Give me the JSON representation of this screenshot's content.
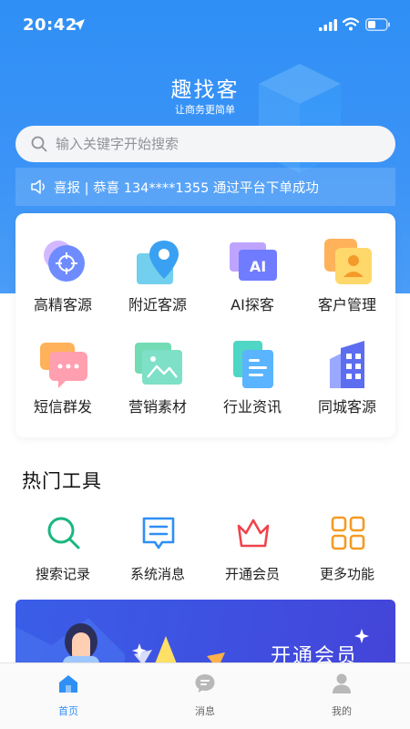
{
  "status_bar": {
    "time": "20:42"
  },
  "header": {
    "title": "趣找客",
    "subtitle": "让商务更简单"
  },
  "search": {
    "placeholder": "输入关键字开始搜索"
  },
  "notice": {
    "text": "喜报 | 恭喜 134****1355 通过平台下单成功"
  },
  "grid": {
    "items": [
      {
        "label": "高精客源",
        "icon": "target-icon"
      },
      {
        "label": "附近客源",
        "icon": "map-pin-icon"
      },
      {
        "label": "AI探客",
        "icon": "ai-icon"
      },
      {
        "label": "客户管理",
        "icon": "user-card-icon"
      },
      {
        "label": "短信群发",
        "icon": "chat-bubble-icon"
      },
      {
        "label": "营销素材",
        "icon": "image-icon"
      },
      {
        "label": "行业资讯",
        "icon": "document-icon"
      },
      {
        "label": "同城客源",
        "icon": "building-icon"
      }
    ]
  },
  "hot_tools": {
    "title": "热门工具",
    "items": [
      {
        "label": "搜索记录",
        "icon": "search-icon",
        "color": "#19b77e"
      },
      {
        "label": "系统消息",
        "icon": "message-icon",
        "color": "#2f8ff5"
      },
      {
        "label": "开通会员",
        "icon": "crown-icon",
        "color": "#f0434b"
      },
      {
        "label": "更多功能",
        "icon": "grid-icon",
        "color": "#f59a23"
      }
    ]
  },
  "banner": {
    "text": "开通会员"
  },
  "tabbar": {
    "items": [
      {
        "label": "首页",
        "icon": "home-icon",
        "active": true
      },
      {
        "label": "消息",
        "icon": "chat-icon",
        "active": false
      },
      {
        "label": "我的",
        "icon": "profile-icon",
        "active": false
      }
    ]
  },
  "colors": {
    "primary": "#2f8ff5",
    "accent_green": "#19b77e",
    "accent_red": "#f0434b",
    "accent_orange": "#f59a23"
  }
}
